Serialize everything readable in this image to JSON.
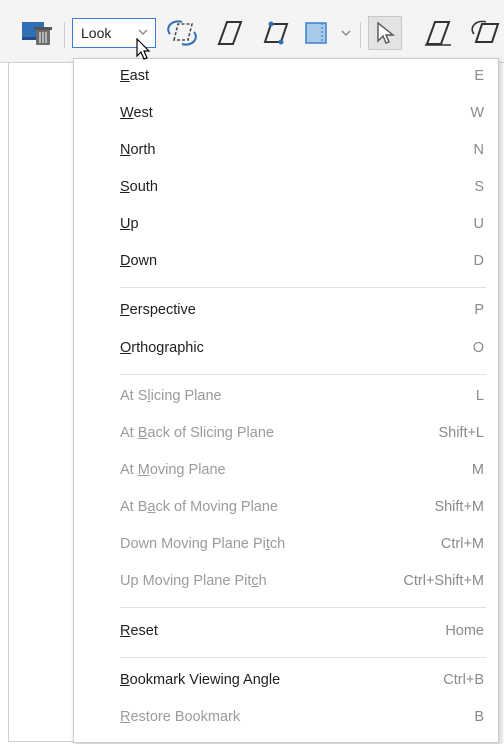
{
  "toolbar": {
    "look_label": "Look"
  },
  "menu": {
    "directions": [
      {
        "pre": "",
        "ul": "E",
        "post": "ast",
        "shortcut": "E"
      },
      {
        "pre": "",
        "ul": "W",
        "post": "est",
        "shortcut": "W"
      },
      {
        "pre": "",
        "ul": "N",
        "post": "orth",
        "shortcut": "N"
      },
      {
        "pre": "",
        "ul": "S",
        "post": "outh",
        "shortcut": "S"
      },
      {
        "pre": "",
        "ul": "U",
        "post": "p",
        "shortcut": "U"
      },
      {
        "pre": "",
        "ul": "D",
        "post": "own",
        "shortcut": "D"
      }
    ],
    "projection": [
      {
        "pre": "",
        "ul": "P",
        "post": "erspective",
        "shortcut": "P"
      },
      {
        "pre": "",
        "ul": "O",
        "post": "rthographic",
        "shortcut": "O"
      }
    ],
    "planes": [
      {
        "pre": "At S",
        "ul": "l",
        "post": "icing Plane",
        "shortcut": "L"
      },
      {
        "pre": "At ",
        "ul": "B",
        "post": "ack of Slicing Plane",
        "shortcut": "Shift+L"
      },
      {
        "pre": "At ",
        "ul": "M",
        "post": "oving Plane",
        "shortcut": "M"
      },
      {
        "pre": "At B",
        "ul": "a",
        "post": "ck of Moving Plane",
        "shortcut": "Shift+M"
      },
      {
        "pre": "Down Moving Plane Pi",
        "ul": "t",
        "post": "ch",
        "shortcut": "Ctrl+M"
      },
      {
        "pre": "Up Moving Plane Pit",
        "ul": "c",
        "post": "h",
        "shortcut": "Ctrl+Shift+M"
      }
    ],
    "reset": {
      "pre": "",
      "ul": "R",
      "post": "eset",
      "shortcut": "Home"
    },
    "bookmark": {
      "pre": "",
      "ul": "B",
      "post": "ookmark Viewing Angle",
      "shortcut": "Ctrl+B"
    },
    "restore": {
      "pre": "",
      "ul": "R",
      "post": "estore Bookmark",
      "shortcut": "B"
    }
  },
  "colors": {
    "accent": "#3c7fd0",
    "disabled_text": "#9b9b9b",
    "shortcut_text": "#8a8a8a"
  }
}
